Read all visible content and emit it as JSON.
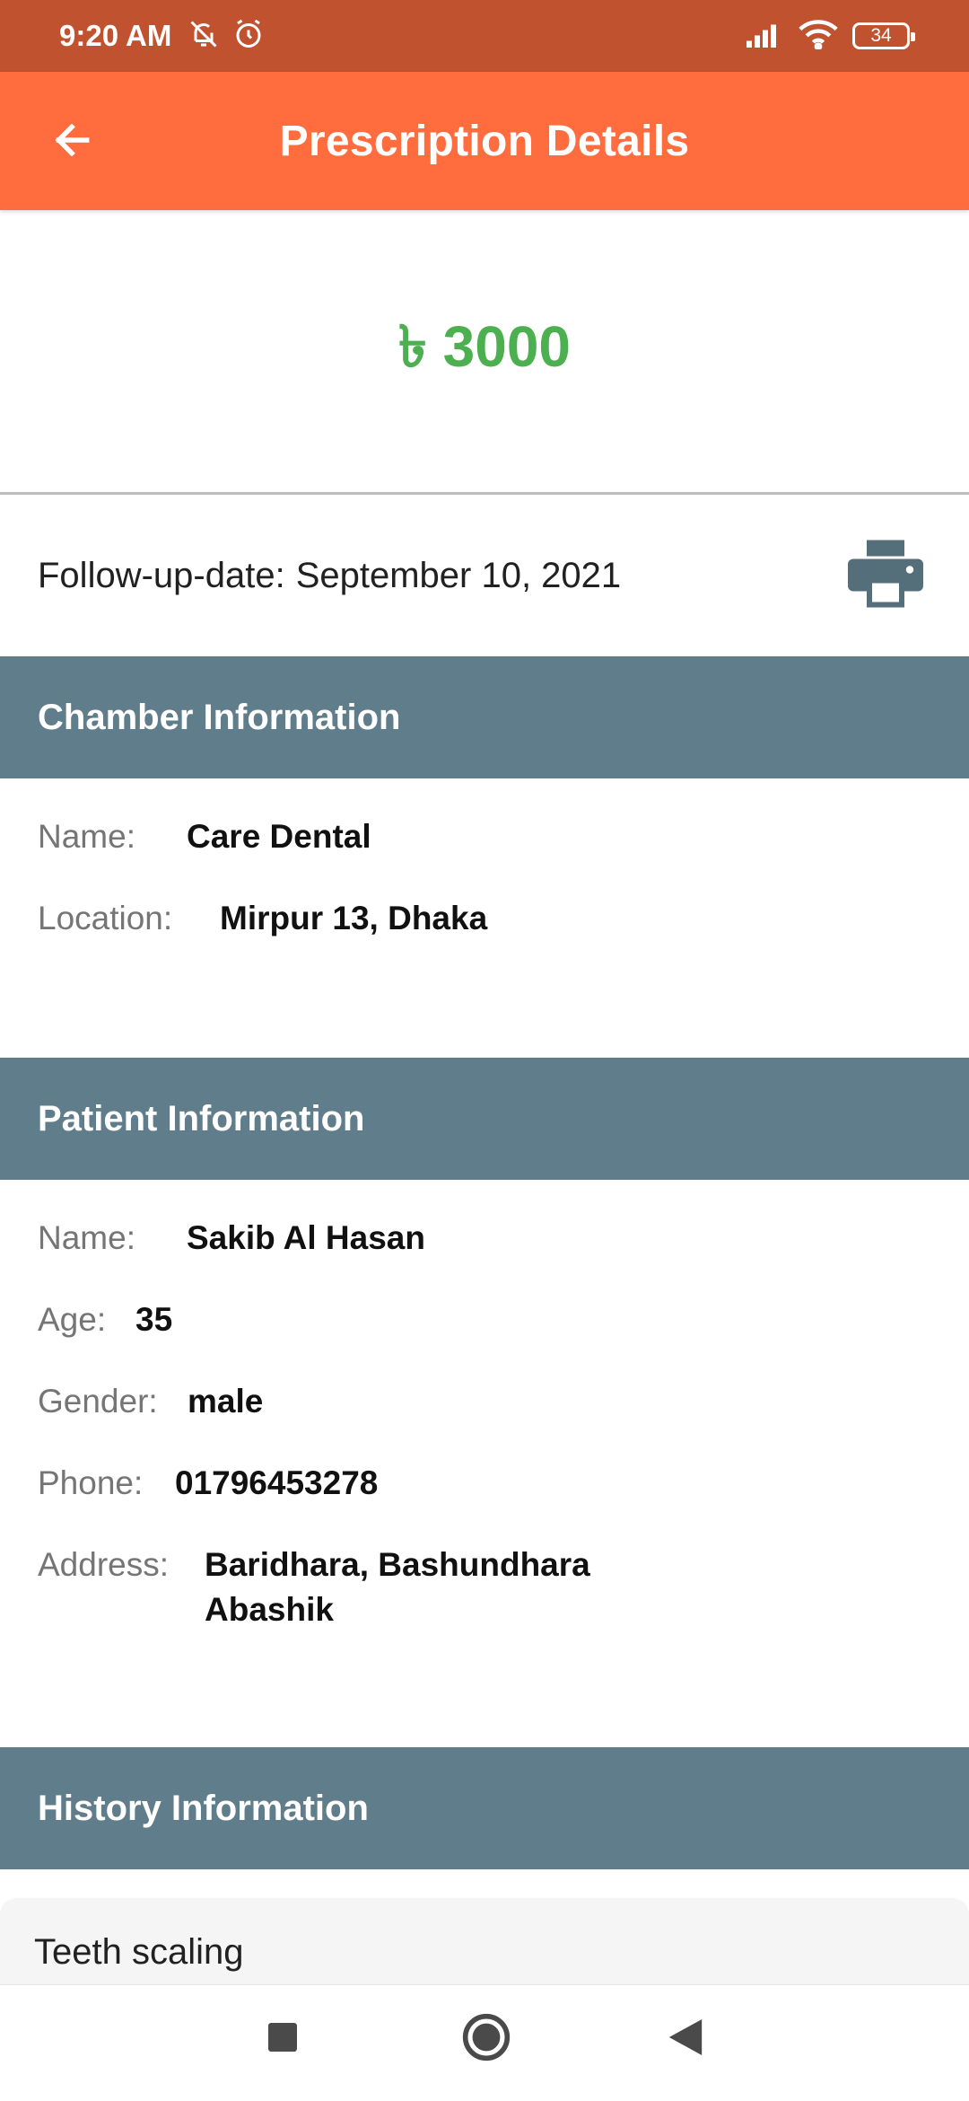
{
  "status_bar": {
    "time": "9:20 AM",
    "battery": "34",
    "icons": [
      "bell-off-icon",
      "alarm-icon",
      "signal-icon",
      "wifi-icon",
      "battery-icon"
    ]
  },
  "app_bar": {
    "title": "Prescription Details",
    "back_icon": "arrow-left-icon"
  },
  "amount": {
    "text": "৳ 3000",
    "color": "#4caf50"
  },
  "followup": {
    "label": "Follow-up-date:",
    "date": "September 10, 2021",
    "print_icon": "printer-icon"
  },
  "chamber": {
    "title": "Chamber Information",
    "name_label": "Name:",
    "name_value": "Care Dental",
    "location_label": "Location:",
    "location_value": "Mirpur 13, Dhaka"
  },
  "patient": {
    "title": "Patient Information",
    "name_label": "Name:",
    "name_value": "Sakib Al Hasan",
    "age_label": "Age:",
    "age_value": "35",
    "gender_label": "Gender:",
    "gender_value": "male",
    "phone_label": "Phone:",
    "phone_value": "01796453278",
    "address_label": "Address:",
    "address_line1": "Baridhara, Bashundhara",
    "address_line2": "Abashik"
  },
  "history": {
    "title": "History Information",
    "items": [
      "Teeth scaling"
    ]
  },
  "colors": {
    "status_bar": "#c0522f",
    "app_bar": "#ff6d3f",
    "section_header": "#607d8b",
    "print_icon": "#546e7a"
  },
  "nav": {
    "icons": [
      "recent-apps-icon",
      "home-icon",
      "back-triangle-icon"
    ]
  }
}
